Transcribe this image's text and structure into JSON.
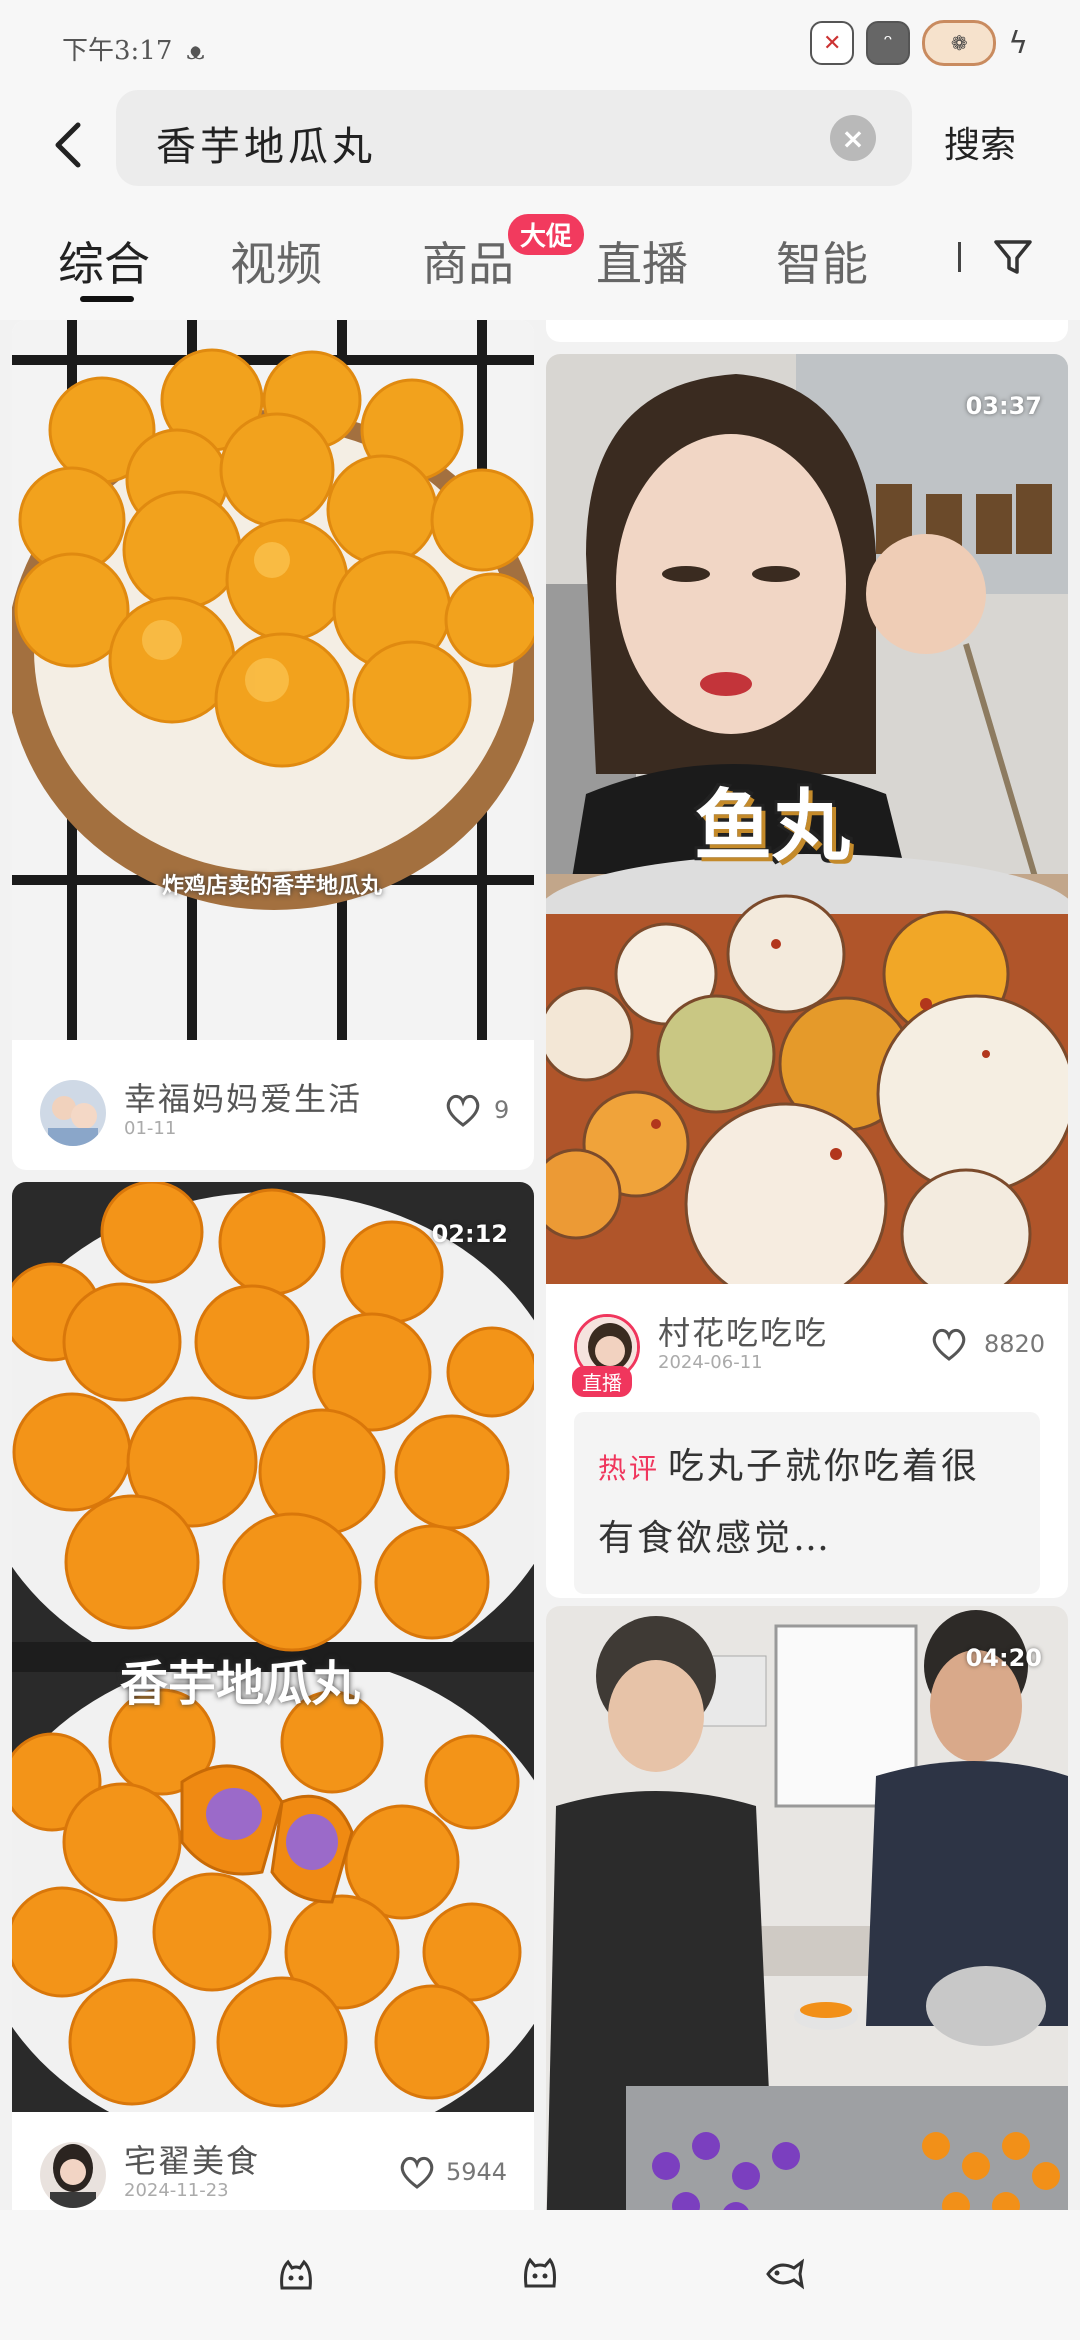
{
  "status_bar": {
    "time": "下午3:17",
    "icons": [
      "cat-icon",
      "cat-icon",
      "fish-icon",
      "bolt-icon"
    ]
  },
  "header": {
    "query": "香芋地瓜丸",
    "search_label": "搜索"
  },
  "tabs": {
    "items": [
      "综合",
      "视频",
      "商品",
      "直播",
      "智能"
    ],
    "active": "综合",
    "badge": "大促"
  },
  "feed": {
    "left": [
      {
        "caption": "炸鸡店卖的香芋地瓜丸",
        "author": "幸福妈妈爱生活",
        "date": "01-11",
        "likes": "9"
      },
      {
        "duration": "02:12",
        "caption": "香芋地瓜丸",
        "author": "宅翟美食",
        "date": "2024-11-23",
        "likes": "5944"
      }
    ],
    "right": [
      {
        "duration": "03:37",
        "caption": "鱼丸",
        "author": "村花吃吃吃",
        "live_badge": "直播",
        "date": "2024-06-11",
        "likes": "8820",
        "hot_label": "热评",
        "hot_comment": "吃丸子就你吃着很有食欲感觉…"
      },
      {
        "duration": "04:20"
      }
    ]
  },
  "colors": {
    "accent": "#f0365d",
    "background": "#f2f2f2",
    "card": "#ffffff"
  }
}
